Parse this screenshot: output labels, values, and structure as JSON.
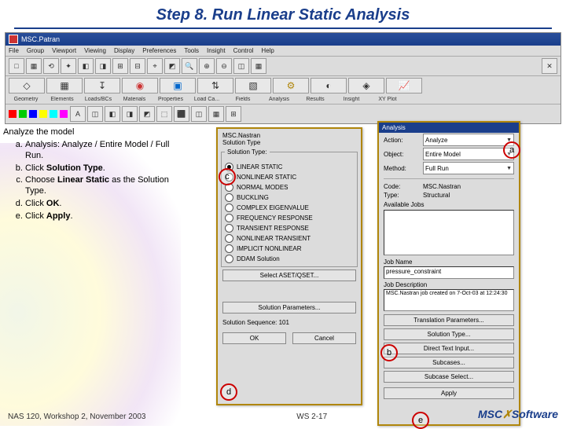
{
  "slide": {
    "title": "Step 8. Run Linear Static Analysis",
    "footer_left": "NAS 120, Workshop 2, November 2003",
    "footer_center": "WS 2-17",
    "logo_prefix": "MSC",
    "logo_suffix": "Software"
  },
  "app": {
    "title": "MSC.Patran",
    "menus": [
      "File",
      "Group",
      "Viewport",
      "Viewing",
      "Display",
      "Preferences",
      "Tools",
      "Insight",
      "Control",
      "Help"
    ],
    "tab_labels": [
      "Geometry",
      "Elements",
      "Loads/BCs",
      "Materials",
      "Properties",
      "Load Ca...",
      "Fields",
      "Analysis",
      "Results",
      "Insight",
      "XY Plot"
    ]
  },
  "instructions": {
    "heading": "Analyze the model",
    "items": [
      "Analysis: Analyze / Entire Model / Full Run.",
      "Click <b>Solution Type</b>.",
      "Choose <b>Linear Static</b> as the Solution Type.",
      "Click <b>OK</b>.",
      "Click <b>Apply</b>."
    ]
  },
  "solution_panel": {
    "title_line": "MSC.Nastran",
    "subtitle": "Solution Type",
    "group": "Solution Type:",
    "options": [
      "LINEAR STATIC",
      "NONLINEAR STATIC",
      "NORMAL MODES",
      "BUCKLING",
      "COMPLEX EIGENVALUE",
      "FREQUENCY RESPONSE",
      "TRANSIENT RESPONSE",
      "NONLINEAR TRANSIENT",
      "IMPLICIT NONLINEAR",
      "DDAM Solution"
    ],
    "selected_index": 0,
    "aset_btn": "Select ASET/QSET...",
    "params_btn": "Solution Parameters...",
    "seq_label": "Solution Sequence: 101",
    "ok_btn": "OK",
    "cancel_btn": "Cancel"
  },
  "analysis_panel": {
    "header": "Analysis",
    "rows": {
      "action_lbl": "Action:",
      "action_val": "Analyze",
      "object_lbl": "Object:",
      "object_val": "Entire Model",
      "method_lbl": "Method:",
      "method_val": "Full Run",
      "code_lbl": "Code:",
      "code_val": "MSC.Nastran",
      "type_lbl": "Type:",
      "type_val": "Structural"
    },
    "avail_label": "Available Jobs",
    "jobname_lbl": "Job Name",
    "jobname_val": "pressure_constraint",
    "jobdesc_lbl": "Job Description",
    "jobdesc_val": "MSC.Nastran job created on 7-Oct-03 at 12:24:30",
    "trans_btn": "Translation Parameters...",
    "soltype_btn": "Solution Type...",
    "direct_btn": "Direct Text Input...",
    "subcase_btn": "Subcases...",
    "subsel_btn": "Subcase Select...",
    "apply_btn": "Apply"
  },
  "callouts": {
    "a": "a",
    "b": "b",
    "c": "c",
    "d": "d",
    "e": "e"
  }
}
